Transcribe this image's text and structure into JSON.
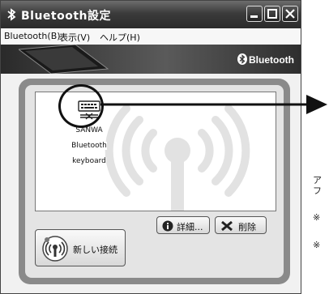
{
  "window": {
    "title": "Bluetooth設定",
    "menu": [
      "Bluetooth(B)",
      "表示(V)",
      "ヘルプ(H)"
    ],
    "brand": "Bluetooth"
  },
  "device": {
    "label_lines": [
      "SANWA",
      "Bluetooth",
      "keyboard"
    ],
    "icon": "keyboard-icon"
  },
  "buttons": {
    "new_connection": "新しい接続",
    "details": "詳細...",
    "delete": "削除"
  },
  "side_text": [
    "ア",
    "フ",
    "※",
    "※"
  ],
  "colors": {
    "titlebar": "#2b2b2b",
    "panel_border": "#8a8a8a",
    "arrow": "#111111"
  }
}
